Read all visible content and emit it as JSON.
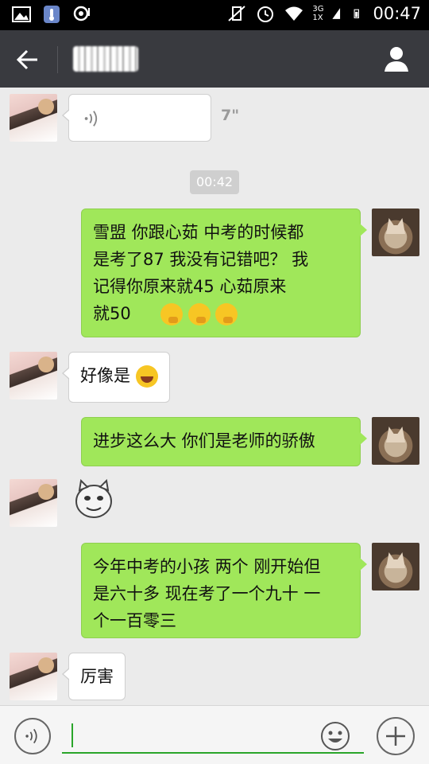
{
  "status_bar": {
    "time": "00:47",
    "network": "3G",
    "network2": "1X"
  },
  "header": {
    "contact_name": "████"
  },
  "messages": [
    {
      "side": "left",
      "type": "voice",
      "duration": "7\""
    },
    {
      "type": "timestamp",
      "text": "00:42"
    },
    {
      "side": "right",
      "type": "text",
      "lines": [
        "雪盟  你跟心茹  中考的时候都",
        "是考了87  我没有记错吧？ 我",
        "记得你原来就45   心茹原来",
        "就50"
      ]
    },
    {
      "side": "left",
      "type": "text",
      "text": "好像是"
    },
    {
      "side": "right",
      "type": "text",
      "text": "进步这么大  你们是老师的骄傲"
    },
    {
      "side": "left",
      "type": "sticker"
    },
    {
      "side": "right",
      "type": "text",
      "lines": [
        "今年中考的小孩 两个 刚开始但",
        "是六十多 现在考了一个九十 一",
        "个一百零三"
      ]
    },
    {
      "side": "left",
      "type": "text",
      "text": "厉害"
    }
  ],
  "input": {
    "value": "",
    "placeholder": ""
  },
  "colors": {
    "topbar": "#393a3f",
    "bubble_right": "#a0e75a",
    "chat_bg": "#ebebeb",
    "accent": "#2aa52a"
  }
}
